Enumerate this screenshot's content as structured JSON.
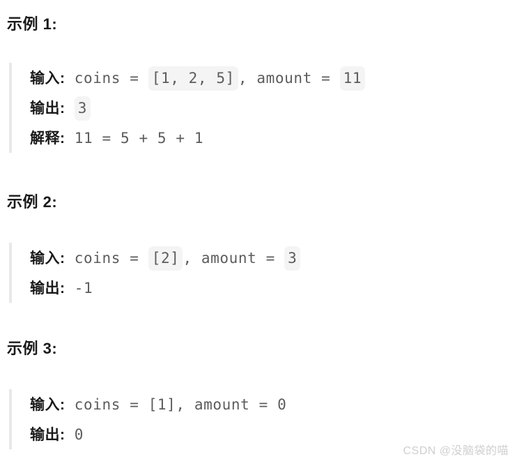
{
  "document": {
    "language": "zh-CN",
    "background_color": "#ffffff",
    "heading_color": "#1a1a1a",
    "code_color": "#5c5c5c",
    "chip_background_color": "#f4f4f5",
    "quote_border_color": "#e8e8e8",
    "watermark_color": "#cfcfcf"
  },
  "examples": [
    {
      "heading": "示例 1:",
      "lines": [
        {
          "label": "输入:",
          "parts": [
            {
              "kind": "code",
              "text": " coins = "
            },
            {
              "kind": "chip",
              "text": "[1, 2, 5]"
            },
            {
              "kind": "code",
              "text": ", amount = "
            },
            {
              "kind": "chip",
              "text": "11"
            }
          ]
        },
        {
          "label": "输出:",
          "parts": [
            {
              "kind": "code",
              "text": " "
            },
            {
              "kind": "chip",
              "text": "3"
            }
          ]
        },
        {
          "label": "解释:",
          "parts": [
            {
              "kind": "code",
              "text": " 11 = 5 + 5 + 1"
            }
          ]
        }
      ]
    },
    {
      "heading": "示例 2:",
      "lines": [
        {
          "label": "输入:",
          "parts": [
            {
              "kind": "code",
              "text": " coins = "
            },
            {
              "kind": "chip",
              "text": "[2]"
            },
            {
              "kind": "code",
              "text": ", amount = "
            },
            {
              "kind": "chip",
              "text": "3"
            }
          ]
        },
        {
          "label": "输出:",
          "parts": [
            {
              "kind": "code",
              "text": " -1"
            }
          ]
        }
      ]
    },
    {
      "heading": "示例 3:",
      "lines": [
        {
          "label": "输入:",
          "parts": [
            {
              "kind": "code",
              "text": " coins = [1], amount = 0"
            }
          ]
        },
        {
          "label": "输出:",
          "parts": [
            {
              "kind": "code",
              "text": " 0"
            }
          ]
        }
      ]
    }
  ],
  "watermark": {
    "text": "CSDN @没脑袋的喵"
  }
}
